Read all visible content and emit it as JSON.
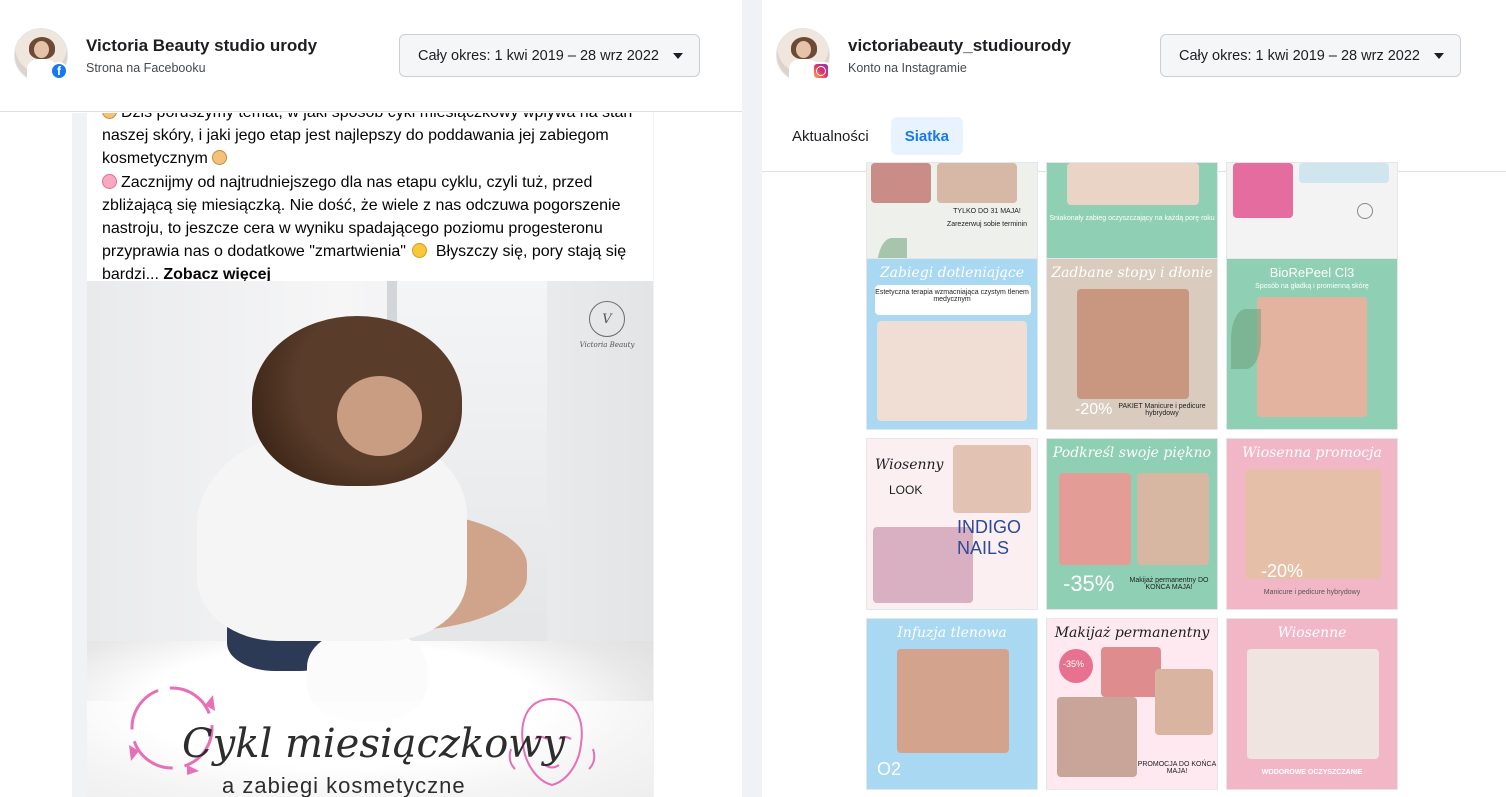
{
  "facebook": {
    "account_name": "Victoria Beauty studio urody",
    "account_type": "Strona na Facebooku",
    "period_label": "Cały okres: 1 kwi 2019 – 28 wrz 2022",
    "post": {
      "line1": "Dziś poruszymy temat, w jaki sposób cykl miesiączkowy wpływa na stan naszej skóry, i jaki jego etap jest najlepszy do poddawania jej zabiegom kosmetycznym",
      "line2": "Zacznijmy od najtrudniejszego dla nas etapu cyklu, czyli tuż, przed zbliżającą się miesiączką. Nie dość, że wiele z nas odczuwa pogorszenie nastroju, to jeszcze cera w wyniku spadającego poziomu progesteronu przyprawia nas o dodatkowe \"zmartwienia\"",
      "line3": "Błyszczy się, pory stają się bardzi...",
      "see_more": "Zobacz więcej",
      "image_logo_letter": "V",
      "image_logo_text": "Victoria Beauty",
      "image_title": "Cykl miesiączkowy",
      "image_subtitle": "a zabiegi kosmetyczne"
    }
  },
  "instagram": {
    "account_name": "victoriabeauty_studiourody",
    "account_type": "Konto na Instagramie",
    "period_label": "Cały okres: 1 kwi 2019 – 28 wrz 2022",
    "tabs": [
      {
        "label": "Aktualności",
        "active": false
      },
      {
        "label": "Siatka",
        "active": true
      }
    ],
    "tiles": {
      "t1_text": "TYLKO DO 31 MAJA!",
      "t1_text2": "Zarezerwuj sobie terminin",
      "t2_text": "Sniakonały zabieg oczyszczający na każdą porę roku",
      "t4_title": "Zabiegi dotleniające",
      "t4_text": "Estetyczna terapia wzmacniająca czystym tlenem medycznym",
      "t5_title": "Zadbane stopy i dłonie",
      "t5_promo": "-20%",
      "t5_text": "PAKIET Manicure i pedicure hybrydowy",
      "t6_title": "BioRePeel Cl3",
      "t6_text": "Sposób na gładką i promienną skórę",
      "t7_title": "Wiosenny",
      "t7_look": "LOOK",
      "t7_brand": "INDIGO NAILS",
      "t8_title": "Podkreśl swoje piękno",
      "t8_promo": "-35%",
      "t8_text": "Makijaż permanentny DO KOŃCA MAJA!",
      "t9_title": "Wiosenna promocja",
      "t9_promo": "-20%",
      "t9_text": "Manicure i pedicure hybrydowy",
      "t10_title": "Infuzja tlenowa",
      "t10_o2": "O2",
      "t11_title": "Makijaż permanentny",
      "t11_promo": "-35%",
      "t11_text": "PROMOCJA DO KOŃCA MAJA!",
      "t12_title": "Wiosenne",
      "t12_text": "WODOROWE OCZYSZCZANIE"
    }
  },
  "colors": {
    "fb_blue": "#1877f2",
    "tab_active_bg": "#e7f3ff",
    "mint": "#8fcfb3",
    "pink": "#f2b7c6",
    "sky": "#a9d8f2",
    "beige": "#d9cbbd"
  }
}
